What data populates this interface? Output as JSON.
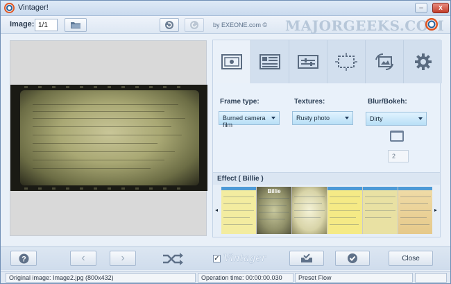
{
  "window": {
    "title": "Vintager!",
    "minimize_label": "–",
    "maximize_label": "□",
    "close_label": "x"
  },
  "toolbar": {
    "image_label": "Image:",
    "image_value": "1/1",
    "by_text": "by EXEONE.com ©",
    "brand": "MAJORGEEKS.COM"
  },
  "tabs": [
    {
      "icon": "frame-icon",
      "active": true
    },
    {
      "icon": "texture-icon",
      "active": false
    },
    {
      "icon": "sliders-icon",
      "active": false
    },
    {
      "icon": "crop-icon",
      "active": false
    },
    {
      "icon": "rotate-image-icon",
      "active": false
    },
    {
      "icon": "gear-icon",
      "active": false
    }
  ],
  "settings": {
    "frame_type_label": "Frame type:",
    "frame_type_value": "Burned camera film",
    "textures_label": "Textures:",
    "textures_value": "Rusty photo",
    "blur_label": "Blur/Bokeh:",
    "blur_value": "Dirty",
    "blur_amount": "2"
  },
  "effect": {
    "title": "Effect ( Billie )",
    "thumbnails": [
      {
        "label": "",
        "color": "#f3eca0"
      },
      {
        "label": "Billie",
        "color": "#9c9c72",
        "selected": true
      },
      {
        "label": "",
        "color": "#ece9c2"
      },
      {
        "label": "",
        "color": "#f5ea86"
      },
      {
        "label": "",
        "color": "#e9e1a3"
      },
      {
        "label": "",
        "color": "#efd7a0"
      }
    ],
    "prev_arrow": "◂",
    "next_arrow": "▸"
  },
  "bottom": {
    "help_icon": "help-icon",
    "prev_label": "‹",
    "next_label": "›",
    "check_mark": "✓",
    "vintager_logo": "Vintager",
    "close_label": "Close"
  },
  "status": {
    "original": "Original image: Image2.jpg (800x432)",
    "operation_time": "Operation time: 00:00:00.030",
    "preset": "Preset Flow",
    "extra": ""
  },
  "colors": {
    "accent": "#4d9ad6",
    "titlebar": "#c9daee",
    "close_button": "#c23d2a"
  }
}
